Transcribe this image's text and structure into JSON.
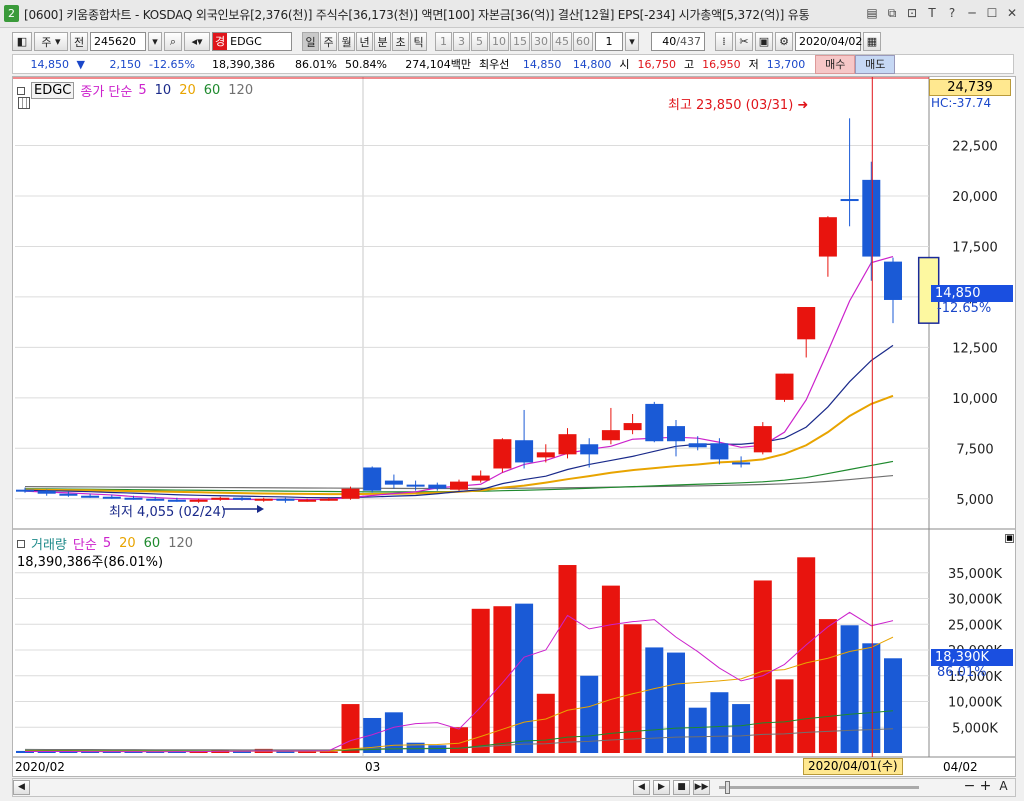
{
  "window": {
    "badge": "2",
    "title": "[0600] 키움종합차트 - KOSDAQ 외국인보유[2,376(천)] 주식수[36,173(천)] 액면[100] 자본금[36(억)] 결산[12월] EPS[-234] 시가총액[5,372(억)] 유통"
  },
  "toolbar": {
    "jusik_label": "주",
    "jeon_label": "전",
    "code": "245620",
    "gyeong_label": "경",
    "name": "EDGC",
    "periods": [
      "일",
      "주",
      "월",
      "년",
      "분",
      "초",
      "틱"
    ],
    "intervals": [
      "1",
      "3",
      "5",
      "10",
      "15",
      "30",
      "45",
      "60"
    ],
    "interval_value": "1",
    "count_value": "40",
    "count_total": "/437",
    "date": "2020/04/02"
  },
  "quote": {
    "price": "14,850",
    "change": "2,150",
    "change_pct": "-12.65%",
    "volume": "18,390,386",
    "vol_ratio": "86.01%",
    "ratio2": "50.84%",
    "amount": "274,104백만",
    "ask_label": "최우선",
    "ask": "14,850",
    "bid": "14,800",
    "open_label": "시",
    "open": "16,750",
    "high_label": "고",
    "high": "16,950",
    "low_label": "저",
    "low": "13,700",
    "buy_label": "매수",
    "sell_label": "매도"
  },
  "price_panel": {
    "symbol": "EDGC",
    "legend_name": "종가 단순",
    "ma_labels": [
      "5",
      "10",
      "20",
      "60",
      "120"
    ],
    "ma_colors": [
      "#cc22cc",
      "#1a2a8a",
      "#e8a400",
      "#1f8a2e",
      "#707070"
    ],
    "top_value": "24,739",
    "hc_value": "HC:-37.74",
    "current_price": "14,850",
    "current_pct": "-12.65%",
    "high_annotation": "최고 23,850 (03/31)",
    "low_annotation": "최저 4,055 (02/24)",
    "ticks": [
      "22,500",
      "20,000",
      "17,500",
      "15,000",
      "12,500",
      "10,000",
      "7,500",
      "5,000"
    ],
    "tick_values": [
      22500,
      20000,
      17500,
      15000,
      12500,
      10000,
      7500,
      5000
    ]
  },
  "volume_panel": {
    "legend_name": "거래량",
    "legend_ma": "단순",
    "ma_labels": [
      "5",
      "20",
      "60",
      "120"
    ],
    "ma_colors": [
      "#cc22cc",
      "#e8a400",
      "#1f8a2e",
      "#707070"
    ],
    "current_text": "18,390,386주(86.01%)",
    "current_value": "18,390K",
    "current_pct": "86.01%",
    "ticks": [
      "35,000K",
      "30,000K",
      "25,000K",
      "20,000K",
      "15,000K",
      "10,000K",
      "5,000K"
    ],
    "tick_values": [
      35000,
      30000,
      25000,
      20000,
      15000,
      10000,
      5000
    ]
  },
  "x_axis": {
    "labels": [
      "2020/02",
      "03"
    ],
    "cursor_date": "2020/04/01(수)",
    "right_label": "04/02"
  },
  "chart_data": {
    "type": "candlestick",
    "price_ylim": [
      3700,
      25500
    ],
    "volume_ylim": [
      0,
      40000
    ],
    "candles": [
      {
        "o": 5450,
        "h": 5550,
        "l": 5300,
        "c": 5400,
        "v": 400
      },
      {
        "o": 5400,
        "h": 5450,
        "l": 5150,
        "c": 5250,
        "v": 300
      },
      {
        "o": 5250,
        "h": 5350,
        "l": 5100,
        "c": 5150,
        "v": 350
      },
      {
        "o": 5150,
        "h": 5250,
        "l": 5050,
        "c": 5100,
        "v": 250
      },
      {
        "o": 5100,
        "h": 5200,
        "l": 5000,
        "c": 5050,
        "v": 200
      },
      {
        "o": 5050,
        "h": 5150,
        "l": 4950,
        "c": 5000,
        "v": 250
      },
      {
        "o": 5000,
        "h": 5100,
        "l": 4900,
        "c": 4950,
        "v": 200
      },
      {
        "o": 4950,
        "h": 5050,
        "l": 4850,
        "c": 4900,
        "v": 250
      },
      {
        "o": 4900,
        "h": 5000,
        "l": 4800,
        "c": 4950,
        "v": 300
      },
      {
        "o": 4950,
        "h": 5100,
        "l": 4900,
        "c": 5050,
        "v": 600
      },
      {
        "o": 5050,
        "h": 5100,
        "l": 4900,
        "c": 4950,
        "v": 300
      },
      {
        "o": 4950,
        "h": 5050,
        "l": 4850,
        "c": 5000,
        "v": 800
      },
      {
        "o": 5000,
        "h": 5050,
        "l": 4800,
        "c": 4900,
        "v": 300
      },
      {
        "o": 4900,
        "h": 5000,
        "l": 4850,
        "c": 4950,
        "v": 500
      },
      {
        "o": 4950,
        "h": 5050,
        "l": 4900,
        "c": 5000,
        "v": 300
      },
      {
        "o": 5000,
        "h": 5600,
        "l": 4950,
        "c": 5500,
        "v": 9500
      },
      {
        "o": 6550,
        "h": 6600,
        "l": 5300,
        "c": 5400,
        "v": 6800
      },
      {
        "o": 5900,
        "h": 6200,
        "l": 5500,
        "c": 5700,
        "v": 7900
      },
      {
        "o": 5700,
        "h": 5900,
        "l": 5400,
        "c": 5600,
        "v": 2000
      },
      {
        "o": 5700,
        "h": 5800,
        "l": 5400,
        "c": 5500,
        "v": 1500
      },
      {
        "o": 5450,
        "h": 5950,
        "l": 5400,
        "c": 5850,
        "v": 5000
      },
      {
        "o": 5900,
        "h": 6400,
        "l": 5800,
        "c": 6150,
        "v": 28000
      },
      {
        "o": 6500,
        "h": 8000,
        "l": 6300,
        "c": 7950,
        "v": 28500
      },
      {
        "o": 7900,
        "h": 9400,
        "l": 6500,
        "c": 6800,
        "v": 29000
      },
      {
        "o": 7050,
        "h": 7700,
        "l": 6800,
        "c": 7300,
        "v": 11500
      },
      {
        "o": 7200,
        "h": 8500,
        "l": 7000,
        "c": 8200,
        "v": 36500
      },
      {
        "o": 7700,
        "h": 8000,
        "l": 6550,
        "c": 7200,
        "v": 15000
      },
      {
        "o": 7900,
        "h": 9500,
        "l": 7700,
        "c": 8400,
        "v": 32500
      },
      {
        "o": 8400,
        "h": 9200,
        "l": 8200,
        "c": 8750,
        "v": 25000
      },
      {
        "o": 9700,
        "h": 9800,
        "l": 7800,
        "c": 7850,
        "v": 20500
      },
      {
        "o": 8600,
        "h": 8900,
        "l": 7100,
        "c": 7850,
        "v": 19500
      },
      {
        "o": 7750,
        "h": 8100,
        "l": 7400,
        "c": 7550,
        "v": 8800
      },
      {
        "o": 7750,
        "h": 8000,
        "l": 6700,
        "c": 6950,
        "v": 11800
      },
      {
        "o": 6800,
        "h": 7100,
        "l": 6550,
        "c": 6700,
        "v": 9500
      },
      {
        "o": 7300,
        "h": 8800,
        "l": 7200,
        "c": 8600,
        "v": 33500
      },
      {
        "o": 9900,
        "h": 11200,
        "l": 9800,
        "c": 11200,
        "v": 14300
      },
      {
        "o": 12900,
        "h": 14500,
        "l": 12000,
        "c": 14500,
        "v": 38000
      },
      {
        "o": 17000,
        "h": 19000,
        "l": 16000,
        "c": 18950,
        "v": 26000
      },
      {
        "o": 19850,
        "h": 23850,
        "l": 18500,
        "c": 19800,
        "v": 24800
      },
      {
        "o": 20800,
        "h": 21700,
        "l": 15800,
        "c": 17000,
        "v": 21300
      },
      {
        "o": 16750,
        "h": 16950,
        "l": 13700,
        "c": 14850,
        "v": 18390
      }
    ],
    "ma5": [
      5380,
      5330,
      5290,
      5240,
      5190,
      5110,
      5060,
      5010,
      4990,
      4980,
      4970,
      4960,
      4970,
      4960,
      4970,
      5070,
      5160,
      5260,
      5340,
      5540,
      5630,
      5720,
      6300,
      6700,
      6900,
      7250,
      7450,
      7600,
      7950,
      8000,
      8050,
      8000,
      7800,
      7550,
      7650,
      8300,
      9900,
      12300,
      14800,
      16700,
      17000
    ],
    "ma10": [
      5420,
      5400,
      5380,
      5350,
      5310,
      5280,
      5240,
      5200,
      5170,
      5150,
      5130,
      5110,
      5090,
      5060,
      5050,
      5060,
      5090,
      5130,
      5160,
      5250,
      5360,
      5450,
      5750,
      5950,
      6120,
      6450,
      6700,
      6900,
      7100,
      7350,
      7600,
      7700,
      7700,
      7700,
      7800,
      8000,
      8550,
      9550,
      10800,
      11850,
      12600
    ],
    "ma20": [
      5450,
      5440,
      5430,
      5420,
      5400,
      5380,
      5360,
      5340,
      5320,
      5300,
      5280,
      5260,
      5250,
      5240,
      5230,
      5230,
      5240,
      5250,
      5260,
      5300,
      5350,
      5410,
      5550,
      5650,
      5800,
      5970,
      6120,
      6290,
      6420,
      6520,
      6620,
      6700,
      6800,
      6850,
      6950,
      7220,
      7650,
      8300,
      9100,
      9700,
      10100
    ],
    "ma60": [
      5500,
      5490,
      5480,
      5470,
      5460,
      5450,
      5440,
      5430,
      5420,
      5410,
      5400,
      5390,
      5380,
      5370,
      5360,
      5350,
      5340,
      5340,
      5340,
      5350,
      5360,
      5370,
      5400,
      5420,
      5450,
      5480,
      5520,
      5560,
      5600,
      5640,
      5680,
      5720,
      5750,
      5790,
      5840,
      5920,
      6050,
      6250,
      6450,
      6650,
      6850
    ],
    "ma120": [
      5600,
      5595,
      5590,
      5585,
      5580,
      5575,
      5570,
      5565,
      5560,
      5555,
      5550,
      5545,
      5540,
      5535,
      5530,
      5525,
      5520,
      5515,
      5510,
      5510,
      5510,
      5515,
      5520,
      5525,
      5535,
      5545,
      5560,
      5575,
      5590,
      5605,
      5620,
      5640,
      5660,
      5680,
      5705,
      5740,
      5790,
      5860,
      5950,
      6050,
      6150
    ],
    "vol_ma5": [
      300,
      290,
      280,
      270,
      270,
      260,
      250,
      260,
      260,
      350,
      360,
      400,
      400,
      400,
      440,
      2400,
      3540,
      5000,
      5700,
      5900,
      4640,
      8900,
      13600,
      18600,
      20000,
      26700,
      24100,
      24900,
      25500,
      25900,
      22500,
      19700,
      16500,
      14000,
      15000,
      17200,
      21000,
      24500,
      27300,
      24700,
      25700
    ],
    "vol_ma20": [
      380,
      370,
      360,
      350,
      340,
      330,
      320,
      320,
      320,
      330,
      330,
      340,
      340,
      340,
      350,
      800,
      1100,
      1500,
      1580,
      1660,
      1900,
      3200,
      4600,
      6000,
      6600,
      8300,
      9000,
      10400,
      11500,
      12500,
      13400,
      13700,
      14000,
      14400,
      15900,
      16200,
      17500,
      18400,
      19700,
      20500,
      22500
    ],
    "vol_ma60": [
      500,
      490,
      480,
      470,
      460,
      450,
      440,
      430,
      420,
      420,
      420,
      420,
      410,
      410,
      410,
      560,
      670,
      800,
      830,
      850,
      920,
      1380,
      1850,
      2330,
      2500,
      3080,
      3300,
      3800,
      4180,
      4500,
      4820,
      4950,
      5150,
      5300,
      5850,
      6050,
      6650,
      7080,
      7520,
      7850,
      8200
    ],
    "vol_ma120": [
      700,
      690,
      680,
      670,
      660,
      650,
      640,
      630,
      620,
      620,
      610,
      610,
      600,
      600,
      600,
      700,
      800,
      870,
      890,
      900,
      950,
      1200,
      1470,
      1720,
      1800,
      2120,
      2250,
      2520,
      2720,
      2900,
      3080,
      3150,
      3250,
      3330,
      3620,
      3720,
      4000,
      4200,
      4400,
      4550,
      4700
    ]
  },
  "scroll": {
    "buttons": [
      "◀",
      "▶",
      "■",
      "▶▶"
    ]
  }
}
